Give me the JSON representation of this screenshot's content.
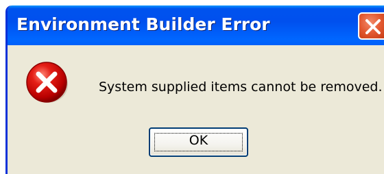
{
  "dialog": {
    "title": "Environment Builder Error",
    "message": "System supplied items cannot be removed.",
    "ok_label": "OK",
    "icon": "error-icon",
    "close_icon": "close-icon"
  },
  "colors": {
    "titlebar": "#0053ee",
    "window_bg": "#ece9d8",
    "close_button": "#e45a32",
    "error_red": "#d00000"
  }
}
